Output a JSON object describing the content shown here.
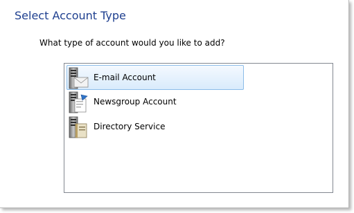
{
  "dialog": {
    "title": "Select Account Type",
    "question": "What type of account would you like to add?"
  },
  "account_types": [
    {
      "label": "E-mail Account",
      "icon": "email-account-icon",
      "selected": true
    },
    {
      "label": "Newsgroup Account",
      "icon": "newsgroup-account-icon",
      "selected": false
    },
    {
      "label": "Directory Service",
      "icon": "directory-service-icon",
      "selected": false
    }
  ],
  "colors": {
    "title": "#1e3f8f",
    "selection_border": "#8bbce8",
    "selection_fill": "#d9ebfc"
  }
}
